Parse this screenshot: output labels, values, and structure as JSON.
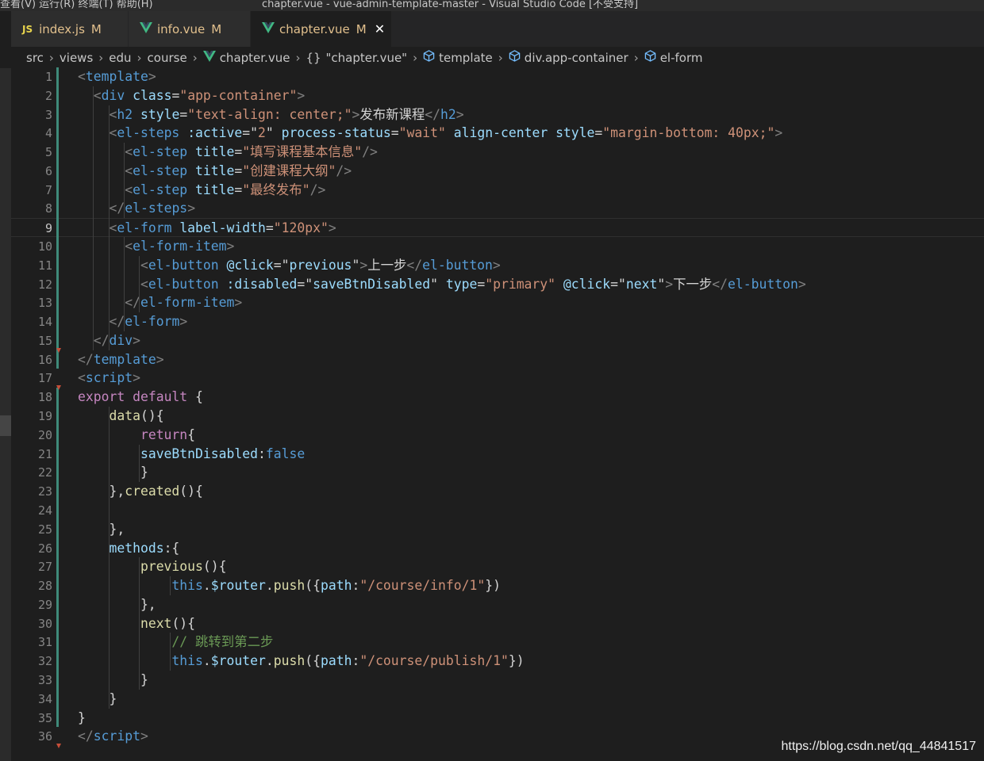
{
  "titlebar": {
    "menu": "查看(V)   运行(R)   终端(T)   帮助(H)",
    "title": "chapter.vue - vue-admin-template-master - Visual Studio Code [不受支持]"
  },
  "tabs": [
    {
      "name": "index.js",
      "status": "M",
      "icon": "js-icon"
    },
    {
      "name": "info.vue",
      "status": "M",
      "icon": "vue-icon"
    },
    {
      "name": "chapter.vue",
      "status": "M",
      "icon": "vue-icon",
      "active": true
    }
  ],
  "breadcrumb": {
    "items": [
      "src",
      "views",
      "edu",
      "course",
      "chapter.vue",
      "\"chapter.vue\"",
      "template",
      "div.app-container",
      "el-form"
    ],
    "braces": "{}"
  },
  "colors": {
    "keyword_tag": "#569cd6",
    "attribute": "#9cdcfe",
    "string": "#ce9178",
    "control": "#c586c0",
    "function": "#dcdcaa",
    "comment": "#6a9955",
    "gutter_modified": "#3f8a7a",
    "gutter_deleted": "#c74e39"
  },
  "editor": {
    "current_line": 9,
    "lines": [
      {
        "n": 1,
        "tokens": [
          [
            "tb",
            "<"
          ],
          [
            "t",
            "template"
          ],
          [
            "tb",
            ">"
          ]
        ]
      },
      {
        "n": 2,
        "tokens": [
          [
            "w",
            "  "
          ],
          [
            "tb",
            "<"
          ],
          [
            "t",
            "div"
          ],
          [
            "w",
            " "
          ],
          [
            "a",
            "class"
          ],
          [
            "w",
            "="
          ],
          [
            "s",
            "\"app-container\""
          ],
          [
            "tb",
            ">"
          ]
        ]
      },
      {
        "n": 3,
        "tokens": [
          [
            "w",
            "    "
          ],
          [
            "tb",
            "<"
          ],
          [
            "t",
            "h2"
          ],
          [
            "w",
            " "
          ],
          [
            "a",
            "style"
          ],
          [
            "w",
            "="
          ],
          [
            "s",
            "\"text-align: center;\""
          ],
          [
            "tb",
            ">"
          ],
          [
            "w",
            "发布新课程"
          ],
          [
            "tb",
            "</"
          ],
          [
            "t",
            "h2"
          ],
          [
            "tb",
            ">"
          ]
        ]
      },
      {
        "n": 4,
        "tokens": [
          [
            "w",
            "    "
          ],
          [
            "tb",
            "<"
          ],
          [
            "t",
            "el-steps"
          ],
          [
            "w",
            " "
          ],
          [
            "a",
            ":active"
          ],
          [
            "w",
            "="
          ],
          [
            "w",
            "\""
          ],
          [
            "s",
            "2"
          ],
          [
            "w",
            "\""
          ],
          [
            "w",
            " "
          ],
          [
            "a",
            "process-status"
          ],
          [
            "w",
            "="
          ],
          [
            "s",
            "\"wait\""
          ],
          [
            "w",
            " "
          ],
          [
            "a",
            "align-center"
          ],
          [
            "w",
            " "
          ],
          [
            "a",
            "style"
          ],
          [
            "w",
            "="
          ],
          [
            "s",
            "\"margin-bottom: 40px;\""
          ],
          [
            "tb",
            ">"
          ]
        ]
      },
      {
        "n": 5,
        "tokens": [
          [
            "w",
            "      "
          ],
          [
            "tb",
            "<"
          ],
          [
            "t",
            "el-step"
          ],
          [
            "w",
            " "
          ],
          [
            "a",
            "title"
          ],
          [
            "w",
            "="
          ],
          [
            "s",
            "\"填写课程基本信息\""
          ],
          [
            "tb",
            "/>"
          ]
        ]
      },
      {
        "n": 6,
        "tokens": [
          [
            "w",
            "      "
          ],
          [
            "tb",
            "<"
          ],
          [
            "t",
            "el-step"
          ],
          [
            "w",
            " "
          ],
          [
            "a",
            "title"
          ],
          [
            "w",
            "="
          ],
          [
            "s",
            "\"创建课程大纲\""
          ],
          [
            "tb",
            "/>"
          ]
        ]
      },
      {
        "n": 7,
        "tokens": [
          [
            "w",
            "      "
          ],
          [
            "tb",
            "<"
          ],
          [
            "t",
            "el-step"
          ],
          [
            "w",
            " "
          ],
          [
            "a",
            "title"
          ],
          [
            "w",
            "="
          ],
          [
            "s",
            "\"最终发布\""
          ],
          [
            "tb",
            "/>"
          ]
        ]
      },
      {
        "n": 8,
        "tokens": [
          [
            "w",
            "    "
          ],
          [
            "tb",
            "</"
          ],
          [
            "t",
            "el-steps"
          ],
          [
            "tb",
            ">"
          ]
        ]
      },
      {
        "n": 9,
        "tokens": [
          [
            "w",
            "    "
          ],
          [
            "tb",
            "<"
          ],
          [
            "t",
            "el-form"
          ],
          [
            "w",
            " "
          ],
          [
            "a",
            "label-width"
          ],
          [
            "w",
            "="
          ],
          [
            "s",
            "\"120px\""
          ],
          [
            "tb",
            ">"
          ]
        ]
      },
      {
        "n": 10,
        "tokens": [
          [
            "w",
            "      "
          ],
          [
            "tb",
            "<"
          ],
          [
            "t",
            "el-form-item"
          ],
          [
            "tb",
            ">"
          ]
        ]
      },
      {
        "n": 11,
        "tokens": [
          [
            "w",
            "        "
          ],
          [
            "tb",
            "<"
          ],
          [
            "t",
            "el-button"
          ],
          [
            "w",
            " "
          ],
          [
            "a",
            "@click"
          ],
          [
            "w",
            "="
          ],
          [
            "w",
            "\""
          ],
          [
            "a",
            "previous"
          ],
          [
            "w",
            "\""
          ],
          [
            "tb",
            ">"
          ],
          [
            "w",
            "上一步"
          ],
          [
            "tb",
            "</"
          ],
          [
            "t",
            "el-button"
          ],
          [
            "tb",
            ">"
          ]
        ]
      },
      {
        "n": 12,
        "tokens": [
          [
            "w",
            "        "
          ],
          [
            "tb",
            "<"
          ],
          [
            "t",
            "el-button"
          ],
          [
            "w",
            " "
          ],
          [
            "a",
            ":disabled"
          ],
          [
            "w",
            "="
          ],
          [
            "w",
            "\""
          ],
          [
            "a",
            "saveBtnDisabled"
          ],
          [
            "w",
            "\""
          ],
          [
            "w",
            " "
          ],
          [
            "a",
            "type"
          ],
          [
            "w",
            "="
          ],
          [
            "s",
            "\"primary\""
          ],
          [
            "w",
            " "
          ],
          [
            "a",
            "@click"
          ],
          [
            "w",
            "="
          ],
          [
            "w",
            "\""
          ],
          [
            "a",
            "next"
          ],
          [
            "w",
            "\""
          ],
          [
            "tb",
            ">"
          ],
          [
            "w",
            "下一步"
          ],
          [
            "tb",
            "</"
          ],
          [
            "t",
            "el-button"
          ],
          [
            "tb",
            ">"
          ]
        ]
      },
      {
        "n": 13,
        "tokens": [
          [
            "w",
            "      "
          ],
          [
            "tb",
            "</"
          ],
          [
            "t",
            "el-form-item"
          ],
          [
            "tb",
            ">"
          ]
        ]
      },
      {
        "n": 14,
        "tokens": [
          [
            "w",
            "    "
          ],
          [
            "tb",
            "</"
          ],
          [
            "t",
            "el-form"
          ],
          [
            "tb",
            ">"
          ]
        ]
      },
      {
        "n": 15,
        "tokens": [
          [
            "w",
            "  "
          ],
          [
            "tb",
            "</"
          ],
          [
            "t",
            "div"
          ],
          [
            "tb",
            ">"
          ]
        ]
      },
      {
        "n": 16,
        "tokens": [
          [
            "tb",
            "</"
          ],
          [
            "t",
            "template"
          ],
          [
            "tb",
            ">"
          ]
        ]
      },
      {
        "n": 17,
        "tokens": [
          [
            "tb",
            "<"
          ],
          [
            "t",
            "script"
          ],
          [
            "tb",
            ">"
          ]
        ]
      },
      {
        "n": 18,
        "tokens": [
          [
            "k",
            "export"
          ],
          [
            "w",
            " "
          ],
          [
            "k",
            "default"
          ],
          [
            "w",
            " {"
          ]
        ]
      },
      {
        "n": 19,
        "tokens": [
          [
            "w",
            "    "
          ],
          [
            "f",
            "data"
          ],
          [
            "w",
            "(){"
          ]
        ]
      },
      {
        "n": 20,
        "tokens": [
          [
            "w",
            "        "
          ],
          [
            "k",
            "return"
          ],
          [
            "w",
            "{"
          ]
        ]
      },
      {
        "n": 21,
        "tokens": [
          [
            "w",
            "        "
          ],
          [
            "a",
            "saveBtnDisabled"
          ],
          [
            "w",
            ":"
          ],
          [
            "t",
            "false"
          ]
        ]
      },
      {
        "n": 22,
        "tokens": [
          [
            "w",
            "        }"
          ]
        ]
      },
      {
        "n": 23,
        "tokens": [
          [
            "w",
            "    },"
          ],
          [
            "f",
            "created"
          ],
          [
            "w",
            "(){"
          ]
        ]
      },
      {
        "n": 24,
        "tokens": [
          [
            "w",
            ""
          ]
        ]
      },
      {
        "n": 25,
        "tokens": [
          [
            "w",
            "    },"
          ]
        ]
      },
      {
        "n": 26,
        "tokens": [
          [
            "w",
            "    "
          ],
          [
            "a",
            "methods"
          ],
          [
            "w",
            ":{"
          ]
        ]
      },
      {
        "n": 27,
        "tokens": [
          [
            "w",
            "        "
          ],
          [
            "f",
            "previous"
          ],
          [
            "w",
            "(){"
          ]
        ]
      },
      {
        "n": 28,
        "tokens": [
          [
            "w",
            "            "
          ],
          [
            "t",
            "this"
          ],
          [
            "w",
            "."
          ],
          [
            "a",
            "$router"
          ],
          [
            "w",
            "."
          ],
          [
            "f",
            "push"
          ],
          [
            "w",
            "({"
          ],
          [
            "a",
            "path"
          ],
          [
            "w",
            ":"
          ],
          [
            "s",
            "\"/course/info/1\""
          ],
          [
            "w",
            "})"
          ]
        ]
      },
      {
        "n": 29,
        "tokens": [
          [
            "w",
            "        },"
          ]
        ]
      },
      {
        "n": 30,
        "tokens": [
          [
            "w",
            "        "
          ],
          [
            "f",
            "next"
          ],
          [
            "w",
            "(){"
          ]
        ]
      },
      {
        "n": 31,
        "tokens": [
          [
            "w",
            "            "
          ],
          [
            "c",
            "// 跳转到第二步"
          ]
        ]
      },
      {
        "n": 32,
        "tokens": [
          [
            "w",
            "            "
          ],
          [
            "t",
            "this"
          ],
          [
            "w",
            "."
          ],
          [
            "a",
            "$router"
          ],
          [
            "w",
            "."
          ],
          [
            "f",
            "push"
          ],
          [
            "w",
            "({"
          ],
          [
            "a",
            "path"
          ],
          [
            "w",
            ":"
          ],
          [
            "s",
            "\"/course/publish/1\""
          ],
          [
            "w",
            "})"
          ]
        ]
      },
      {
        "n": 33,
        "tokens": [
          [
            "w",
            "        }"
          ]
        ]
      },
      {
        "n": 34,
        "tokens": [
          [
            "w",
            "    }"
          ]
        ]
      },
      {
        "n": 35,
        "tokens": [
          [
            "w",
            "}"
          ]
        ]
      },
      {
        "n": 36,
        "tokens": [
          [
            "tb",
            "</"
          ],
          [
            "t",
            "script"
          ],
          [
            "tb",
            ">"
          ]
        ]
      }
    ]
  },
  "watermark": "https://blog.csdn.net/qq_44841517"
}
